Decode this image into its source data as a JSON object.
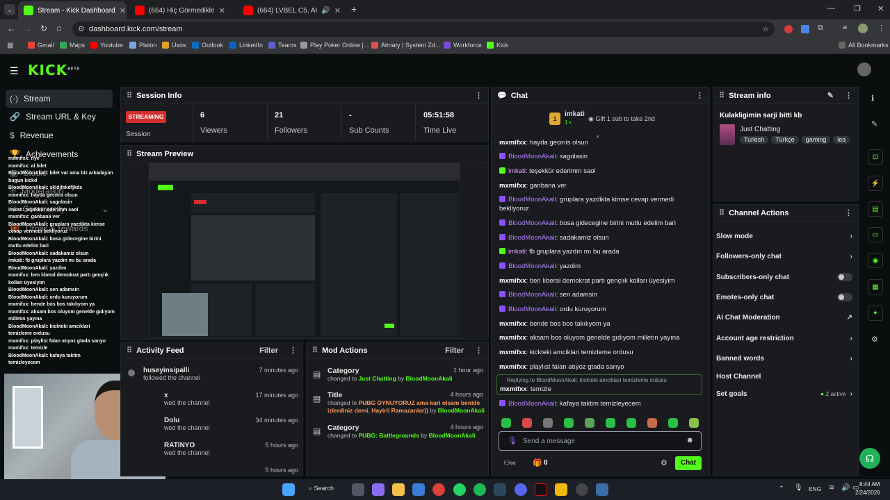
{
  "browser": {
    "tabs": [
      {
        "title": "Stream - Kick Dashboard",
        "color": "#53fc18"
      },
      {
        "title": "(664) Hiç Görmedikleriniz | Ara...",
        "color": "#ff0000"
      },
      {
        "title": "(664) LVBEL C5, AKDO - ÇO...",
        "color": "#ff0000"
      }
    ],
    "url": "dashboard.kick.com/stream",
    "bookmarks": [
      "Gmail",
      "Maps",
      "Youtube",
      "Platon",
      "Usos",
      "Outlook",
      "LinkedIn",
      "Teams",
      "Play Poker Online |...",
      "Almaty | System Zd...",
      "Workforce",
      "Kick"
    ],
    "all_bookmarks": "All Bookmarks"
  },
  "kick": {
    "logo": "KICK",
    "logo_beta": "BETA",
    "nav": [
      {
        "label": "Stream",
        "icon": "stream-icon"
      },
      {
        "label": "Stream URL & Key",
        "icon": "link-icon"
      },
      {
        "label": "Revenue",
        "icon": "revenue-icon"
      },
      {
        "label": "Achievements",
        "icon": "trophy-icon"
      },
      {
        "label": "Studio",
        "icon": "studio-icon"
      },
      {
        "label": "Moderation",
        "icon": "shield-icon"
      },
      {
        "label": "Community",
        "icon": "community-icon"
      },
      {
        "label": "Drops & rewards",
        "icon": "gift-icon"
      }
    ]
  },
  "session": {
    "title": "Session Info",
    "status": "STREAMING",
    "status_label": "Session",
    "viewers": "6",
    "viewers_label": "Viewers",
    "followers": "21",
    "followers_label": "Followers",
    "subs": "-",
    "subs_label": "Sub Counts",
    "time": "05:51:58",
    "time_label": "Time Live"
  },
  "preview": {
    "title": "Stream Preview"
  },
  "activity": {
    "title": "Activity Feed",
    "filter": "Filter",
    "items": [
      {
        "user": "huseyinsipalli",
        "action": "followed the channel",
        "time": "7 minutes ago"
      },
      {
        "user": "x",
        "action": "wed the channel",
        "time": "17 minutes ago"
      },
      {
        "user": "Dolu",
        "action": "wed the channel",
        "time": "34 minutes ago"
      },
      {
        "user": "RATINYO",
        "action": "wed the channel",
        "time": "5 hours ago"
      },
      {
        "user": "",
        "action": "",
        "time": "5 hours ago"
      }
    ]
  },
  "mod": {
    "title": "Mod Actions",
    "filter": "Filter",
    "items": [
      {
        "type": "Category",
        "prefix": "changed to",
        "target": "Just Chatting",
        "by": "by",
        "user": "BloodMoonAkali",
        "time": "1 hour ago"
      },
      {
        "type": "Title",
        "prefix": "changed to",
        "target": "PUBG OYNUYORUZ ama kari olsam benide izlerdiniz demi. Hayirli Ramazanlar))",
        "by": "by",
        "user": "BloodMoonAkali",
        "time": "4 hours ago"
      },
      {
        "type": "Category",
        "prefix": "changed to",
        "target": "PUBG: Battlegrounds",
        "by": "by",
        "user": "BloodMoonAkali",
        "time": "4 hours ago"
      }
    ]
  },
  "chat": {
    "title": "Chat",
    "pinned_user": "imkati",
    "pinned_count": "1",
    "gift_text": "Gift 1 sub to take 2nd",
    "messages": [
      {
        "user": "mxmifxx",
        "text": ": hayda gecmis olsun",
        "cls": "w"
      },
      {
        "user": "BloodMoonAkali",
        "text": ": sagolasin",
        "cls": "p"
      },
      {
        "user": "imkati",
        "text": ": teşekkür ederimm saol",
        "cls": "g"
      },
      {
        "user": "mxmifxx",
        "text": ": ganbana ver",
        "cls": "w"
      },
      {
        "user": "BloodMoonAkali",
        "text": ": gruplara yazdikta kimse cevap vermedi bekliyoruz",
        "cls": "p"
      },
      {
        "user": "BloodMoonAkali",
        "text": ": bosa gidecegine birini mutlu edelim bari",
        "cls": "p"
      },
      {
        "user": "BloodMoonAkali",
        "text": ": sadakamiz olsun",
        "cls": "p"
      },
      {
        "user": "imkati",
        "text": ": fb gruplara yazdın mı bu arada",
        "cls": "g"
      },
      {
        "user": "BloodMoonAkali",
        "text": ": yazdim",
        "cls": "p"
      },
      {
        "user": "mxmifxx",
        "text": ": ben lıberal demokrat partı gençlık kolları üyesiyim",
        "cls": "w"
      },
      {
        "user": "BloodMoonAkali",
        "text": ": sen adamsin",
        "cls": "p"
      },
      {
        "user": "BloodMoonAkali",
        "text": ": ordu kuruyorum",
        "cls": "p"
      },
      {
        "user": "mxmifxx",
        "text": ": bende bos bos takılıyom ya",
        "cls": "w"
      },
      {
        "user": "mxmifxx",
        "text": ": aksam bos oluyom genelde gıdıyom milletın yayına",
        "cls": "w"
      },
      {
        "user": "mxmifxx",
        "text": ": kickteki amciklari temizleme ordusu",
        "cls": "w"
      },
      {
        "user": "mxmifxx",
        "text": ": playlıst falan atıyoz gtada sarıyo",
        "cls": "w"
      }
    ],
    "reply_to": "Replying to BloodMoonAkali: kickteki amciklari temizleme ordusu",
    "reply_user": "mxmifxx",
    "reply_text": ": temizle",
    "last_user": "BloodMoonAkali",
    "last_text": ": kafaya taktim temizleyecem",
    "input_placeholder": "Send a message",
    "count": "0",
    "send": "Chat"
  },
  "stream_info": {
    "title": "Stream info",
    "stream_title": "Kulakligimin sarji bitti kb",
    "category": "Just Chatting",
    "tags": [
      "Turkish",
      "Türkçe",
      "gaming",
      "lea"
    ]
  },
  "channel_actions": {
    "title": "Channel Actions",
    "rows": [
      {
        "label": "Slow mode",
        "ctrl": "chevron"
      },
      {
        "label": "Followers-only chat",
        "ctrl": "chevron"
      },
      {
        "label": "Subscribers-only chat",
        "ctrl": "toggle"
      },
      {
        "label": "Emotes-only chat",
        "ctrl": "toggle"
      },
      {
        "label": "AI Chat Moderation",
        "ctrl": "external"
      },
      {
        "label": "Account age restriction",
        "ctrl": "chevron"
      },
      {
        "label": "Banned words",
        "ctrl": "chevron"
      },
      {
        "label": "Host Channel",
        "ctrl": "none"
      },
      {
        "label": "Set goals",
        "ctrl": "chevron"
      }
    ],
    "goals_status": "2 active"
  },
  "overlay_chat": [
    "mxmifxx: nye",
    "mxmifxx: al bilet",
    "BloodMoonAkali: bilet var ama biz arkadasim",
    "bugun kickd",
    "BloodMoonAkali: skldjfskdfjkds",
    "mxmifxx: hayda gecmis olsun",
    "BloodMoonAkali: sagolasin",
    "imkati: teşekkür ederimm saol",
    "mxmifxx: ganbana ver",
    "BloodMoonAkali: gruplara yazdikta kimse",
    "cevap vermedi bekliyoruz",
    "BloodMoonAkali: bosa gidecegine birini",
    "mutlu edelim bari",
    "BloodMoonAkali: sadakamiz olsun",
    "imkati: fb gruplara yazdın mı bu arada",
    "BloodMoonAkali: yazdim",
    "mxmifxx: ben lıberal demokrat partı gençlık",
    "kolları üyesiyim",
    "BloodMoonAkali: sen adamsin",
    "BloodMoonAkali: ordu kuruyorum",
    "mxmifxx: bende bos bos takılıyom ya",
    "mxmifxx: aksam bos oluyom genelde gıdıyom",
    "milletın yayına",
    "BloodMoonAkali: kickteki amciklari",
    "temizleme ordusu",
    "mxmifxx: playlist falan atıyoz gtada sarıyo",
    "mxmifxx: temizle",
    "BloodMoonAkali: kafaya taktim",
    "temizleyecem"
  ],
  "taskbar": {
    "search": "Search",
    "lang": "ENG",
    "time": "8:44 AM",
    "date": "2/24/2026"
  }
}
